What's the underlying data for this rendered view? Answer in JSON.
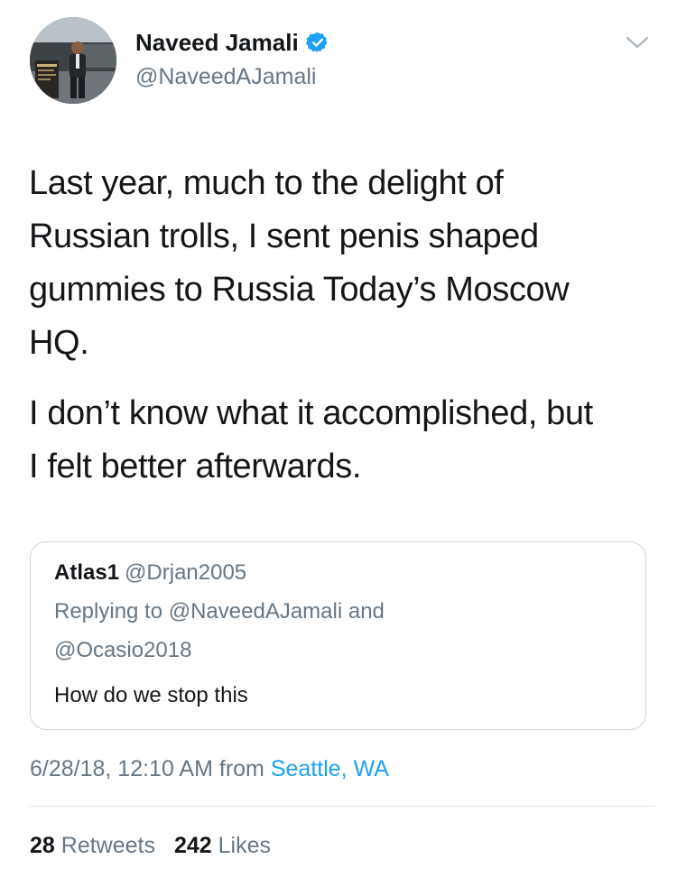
{
  "author": {
    "display_name": "Naveed Jamali",
    "handle": "@NaveedAJamali",
    "verified": true,
    "avatar_icon": "profile-photo-avatar"
  },
  "tweet": {
    "paragraph_1_lines": [
      "Last year, much to the delight of",
      "Russian trolls, I sent penis shaped",
      "gummies to Russia Today’s Moscow",
      "HQ."
    ],
    "paragraph_2_lines": [
      "I don’t know what it accomplished, but",
      "I felt better afterwards."
    ]
  },
  "quoted_tweet": {
    "display_name": "Atlas1",
    "handle": "@Drjan2005",
    "replying_line_1": "Replying to @NaveedAJamali and",
    "replying_line_2": "@Ocasio2018",
    "text": "How do we stop this"
  },
  "meta": {
    "timestamp": "6/28/18, 12:10 AM from",
    "location": "Seattle, WA"
  },
  "stats": {
    "retweets_count": "28",
    "retweets_label": "Retweets",
    "likes_count": "242",
    "likes_label": "Likes"
  },
  "icons": {
    "verified": "verified-badge-icon",
    "caret": "chevron-down-icon"
  },
  "colors": {
    "text_primary": "#14171a",
    "text_secondary": "#657786",
    "link_blue": "#1da1f2",
    "border": "#ccd6dd",
    "divider": "#e1e8ed"
  }
}
